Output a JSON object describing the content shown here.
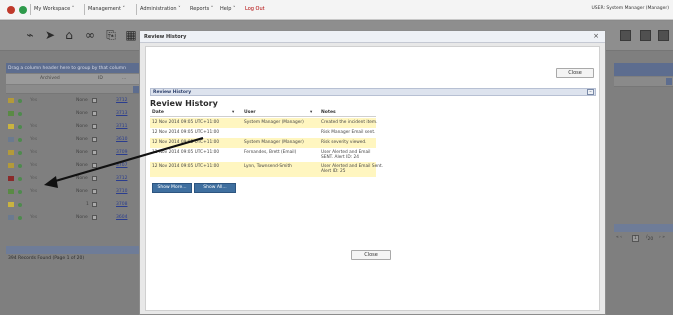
{
  "topbar": {
    "menus": [
      "My Workspace",
      "Management",
      "Administration",
      "Reports",
      "Help"
    ],
    "logout": "Log Out",
    "user": "USER: System Manager (Manager)"
  },
  "background": {
    "grid_hint": "Drag a column header here to group by that column",
    "columns": [
      "Archived",
      "ID",
      "..."
    ],
    "rows": [
      {
        "icon": "warning-icon",
        "status": "Yes",
        "reviewed": "None",
        "id": "3712"
      },
      {
        "icon": "check-icon",
        "status": "",
        "reviewed": "None",
        "id": "3713"
      },
      {
        "icon": "document-icon",
        "status": "Yes",
        "reviewed": "None",
        "id": "3711"
      },
      {
        "icon": "people-icon",
        "status": "Yes",
        "reviewed": "None",
        "id": "3610"
      },
      {
        "icon": "warning-icon",
        "status": "Yes",
        "reviewed": "None",
        "id": "3709"
      },
      {
        "icon": "warning-icon",
        "status": "Yes",
        "reviewed": "None",
        "id": "3707"
      },
      {
        "icon": "stop-icon",
        "status": "Yes",
        "reviewed": "None",
        "id": "3712"
      },
      {
        "icon": "check-icon",
        "status": "Yes",
        "reviewed": "None",
        "id": "3710"
      },
      {
        "icon": "document-icon",
        "status": "",
        "reviewed": "1",
        "id": "3708"
      },
      {
        "icon": "people-icon",
        "status": "Yes",
        "reviewed": "None",
        "id": "3604"
      }
    ],
    "records": "394 Records Found (Page 1 of 20)",
    "pager": {
      "prev": "« ‹",
      "page": "1",
      "total": "20",
      "next": "› »"
    }
  },
  "modal": {
    "title": "Review History",
    "close_top_label": "Close",
    "panel_header": "Review History",
    "heading": "Review History",
    "columns": {
      "date": "Date",
      "user": "User",
      "notes": "Notes"
    },
    "rows": [
      {
        "date": "12 Nov 2014 09:05 UTC+11:00",
        "user": "System Manager (Manager)",
        "notes": "Created the incident item."
      },
      {
        "date": "12 Nov 2014 09:05 UTC+11:00",
        "user": "",
        "notes": "Risk Manager Email sent."
      },
      {
        "date": "12 Nov 2014 09:05 UTC+11:00",
        "user": "System Manager (Manager)",
        "notes": "Risk severity viewed."
      },
      {
        "date": "12 Nov 2014 09:05 UTC+11:00",
        "user": "Fernandes, Brett (Email)",
        "notes": "User Alerted and Email SENT. Alert ID: 24"
      },
      {
        "date": "12 Nov 2014 09:05 UTC+11:00",
        "user": "Lynn, Townsend-Smith",
        "notes": "User Alerted and Email Sent. Alert ID: 25"
      }
    ],
    "show_more": "Show More...",
    "show_all": "Show All...",
    "close_bottom_label": "Close"
  }
}
